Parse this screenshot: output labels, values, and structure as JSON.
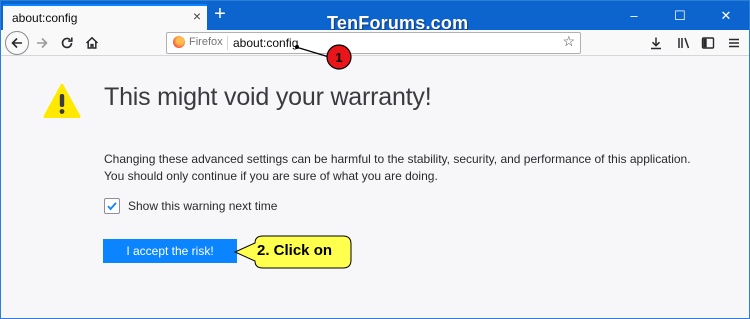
{
  "tab": {
    "title": "about:config",
    "close_glyph": "×"
  },
  "new_tab_glyph": "+",
  "watermark": "TenForums.com",
  "window_controls": {
    "minimize": "–",
    "maximize": "☐",
    "close": "✕"
  },
  "toolbar": {
    "back_icon": "back-arrow-icon",
    "forward_icon": "forward-arrow-icon",
    "reload_icon": "reload-icon",
    "home_icon": "home-icon",
    "right_icons": [
      "download-icon",
      "library-icon",
      "sidebar-icon",
      "menu-icon"
    ]
  },
  "urlbar": {
    "identity_label": "Firefox",
    "url": "about:config",
    "bookmark_icon": "star-icon"
  },
  "page": {
    "heading": "This might void your warranty!",
    "body": "Changing these advanced settings can be harmful to the stability, security, and performance of this application. You should only continue if you are sure of what you are doing.",
    "checkbox_label": "Show this warning next time",
    "checkbox_checked": true,
    "accept_label": "I accept the risk!"
  },
  "annotations": {
    "step1": "1",
    "step2": "2. Click on"
  },
  "colors": {
    "accent": "#0a84ff",
    "titlebar": "#0c64cf",
    "warning": "#ffe900",
    "callout_red": "#e8161b",
    "callout_yellow": "#ffff4d"
  }
}
